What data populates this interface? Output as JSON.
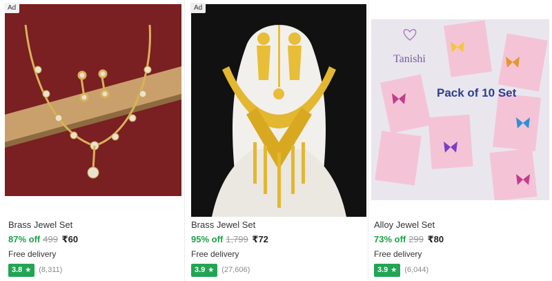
{
  "products": [
    {
      "ad": "Ad",
      "title": "Brass Jewel Set",
      "discount": "87% off",
      "mrp": "499",
      "price": "₹60",
      "delivery": "Free delivery",
      "rating": "3.8",
      "reviews": "(8,311)"
    },
    {
      "ad": "Ad",
      "title": "Brass Jewel Set",
      "discount": "95% off",
      "mrp": "1,799",
      "price": "₹72",
      "delivery": "Free delivery",
      "rating": "3.9",
      "reviews": "(27,606)"
    },
    {
      "title": "Alloy Jewel Set",
      "discount": "73% off",
      "mrp": "299",
      "price": "₹80",
      "delivery": "Free delivery",
      "rating": "3.9",
      "reviews": "(6,044)",
      "image_text": {
        "brand": "Tanishi",
        "pack": "Pack of 10 Set"
      }
    }
  ],
  "colors": {
    "discount": "#1aa34a",
    "rating_badge": "#23a455"
  }
}
